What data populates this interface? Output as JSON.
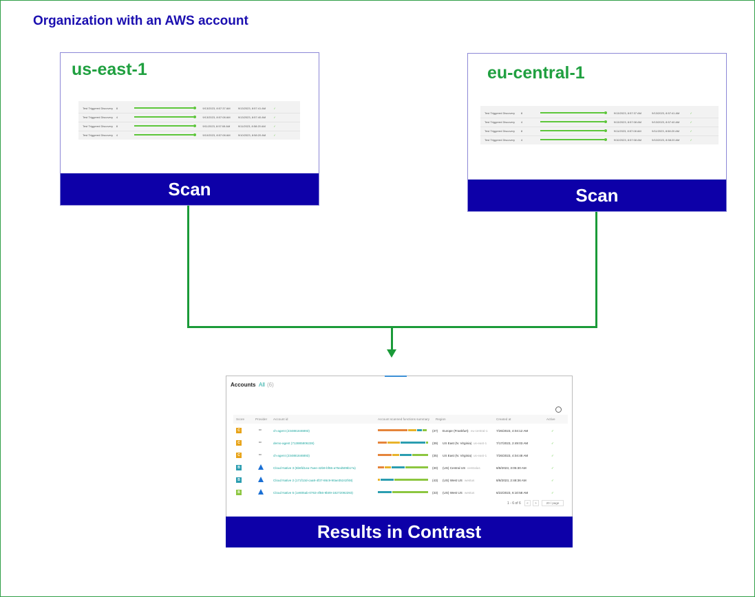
{
  "org_title": "Organization with an AWS account",
  "regions": [
    {
      "name": "us-east-1",
      "scan_label": "Scan",
      "rows": [
        {
          "name": "Test Triggered Discovery",
          "count": "8",
          "start": "9/13/2023, 8:57:37 AM",
          "end": "9/13/2023, 8:57:41 AM",
          "status": "✓"
        },
        {
          "name": "Test Triggered Discovery",
          "count": "4",
          "start": "9/13/2023, 8:57:08 AM",
          "end": "9/13/2023, 8:57:40 AM",
          "status": "✓"
        },
        {
          "name": "Test Triggered Discovery",
          "count": "8",
          "start": "9/11/2023, 8:57:08 AM",
          "end": "9/11/2023, 8:58:20 AM",
          "status": "✓"
        },
        {
          "name": "Test Triggered Discovery",
          "count": "4",
          "start": "9/10/2023, 8:57:08 AM",
          "end": "9/10/2023, 8:58:20 AM",
          "status": "✓"
        }
      ]
    },
    {
      "name": "eu-central-1",
      "scan_label": "Scan",
      "rows": [
        {
          "name": "Test Triggered Discovery",
          "count": "8",
          "start": "9/13/2023, 8:57:37 AM",
          "end": "9/13/2023, 8:57:41 AM",
          "status": "✓"
        },
        {
          "name": "Test Triggered Discovery",
          "count": "4",
          "start": "9/13/2023, 8:57:08 AM",
          "end": "9/13/2023, 8:57:40 AM",
          "status": "✓"
        },
        {
          "name": "Test Triggered Discovery",
          "count": "8",
          "start": "9/11/2023, 8:57:08 AM",
          "end": "9/11/2023, 8:58:20 AM",
          "status": "✓"
        },
        {
          "name": "Test Triggered Discovery",
          "count": "4",
          "start": "9/10/2023, 8:57:08 AM",
          "end": "9/10/2023, 8:58:20 AM",
          "status": "✓"
        }
      ]
    }
  ],
  "results": {
    "title": "Accounts",
    "filter_all": "All",
    "filter_count": "(6)",
    "columns": [
      "Score",
      "Provider",
      "Account id",
      "Account scanned functions summary",
      "Region",
      "Created at",
      "Active"
    ],
    "rows": [
      {
        "score": "C",
        "score_color": "#e8a317",
        "provider": "aws",
        "account": "ch-agent (234881846893)",
        "count": "(37)",
        "region": "Europe (Frankfurt)",
        "region_code": "eu-central-1",
        "created": "7/26/2023, 4:04:12 AM",
        "segments": [
          {
            "frac": 0.58,
            "color": "#e5843a"
          },
          {
            "frac": 0.17,
            "color": "#e8b32a"
          },
          {
            "frac": 0.1,
            "color": "#2a9db0"
          },
          {
            "frac": 0.1,
            "color": "#8cc63f"
          }
        ]
      },
      {
        "score": "C",
        "score_color": "#e8a317",
        "provider": "aws",
        "account": "demo-agent (713885806228)",
        "count": "(39)",
        "region": "US East (N. Virginia)",
        "region_code": "us-east-1",
        "created": "7/17/2023, 2:49:03 AM",
        "segments": [
          {
            "frac": 0.18,
            "color": "#e5843a"
          },
          {
            "frac": 0.26,
            "color": "#e8b32a"
          },
          {
            "frac": 0.48,
            "color": "#2a9db0"
          },
          {
            "frac": 0.05,
            "color": "#8cc63f"
          }
        ]
      },
      {
        "score": "C",
        "score_color": "#e8a317",
        "provider": "aws",
        "account": "ch-agent (234881846893)",
        "count": "(35)",
        "region": "US East (N. Virginia)",
        "region_code": "us-east-1",
        "created": "7/26/2023, 4:04:48 AM",
        "segments": [
          {
            "frac": 0.28,
            "color": "#e5843a"
          },
          {
            "frac": 0.14,
            "color": "#e8b32a"
          },
          {
            "frac": 0.24,
            "color": "#2a9db0"
          },
          {
            "frac": 0.32,
            "color": "#8cc63f"
          }
        ]
      },
      {
        "score": "B",
        "score_color": "#2a9db0",
        "provider": "azure",
        "account": "Cloud Native 3 (6b6fd1ea-7aee-42b9-bf55-a75ed509b17a)",
        "count": "(30)",
        "region": "(US) Central US",
        "region_code": "centralus",
        "created": "8/8/2023, 3:05:30 AM",
        "segments": [
          {
            "frac": 0.13,
            "color": "#e5843a"
          },
          {
            "frac": 0.13,
            "color": "#e8b32a"
          },
          {
            "frac": 0.27,
            "color": "#2a9db0"
          },
          {
            "frac": 0.45,
            "color": "#8cc63f"
          }
        ]
      },
      {
        "score": "B",
        "score_color": "#2a9db0",
        "provider": "azure",
        "account": "Cloud Native 2 (171f13d-caa8-4f37-86c9-90ae35242f48)",
        "count": "(43)",
        "region": "(US) West US",
        "region_code": "westus",
        "created": "8/8/2023, 2:48:36 AM",
        "segments": [
          {
            "frac": 0.05,
            "color": "#e8b32a"
          },
          {
            "frac": 0.27,
            "color": "#2a9db0"
          },
          {
            "frac": 0.66,
            "color": "#8cc63f"
          }
        ]
      },
      {
        "score": "B",
        "score_color": "#8cc63f",
        "provider": "azure",
        "account": "Cloud Native 5 (1e805ab-0763-4f56-9b09-18272092293)",
        "count": "(33)",
        "region": "(US) West US",
        "region_code": "westus",
        "created": "6/22/2023, 6:10:58 AM",
        "segments": [
          {
            "frac": 0.28,
            "color": "#2a9db0"
          },
          {
            "frac": 0.7,
            "color": "#8cc63f"
          }
        ]
      }
    ],
    "pagination": "1 - 6 of 6",
    "page_prev": "<",
    "page_next": ">",
    "page_size": "20 / page",
    "banner": "Results in Contrast"
  },
  "colors": {
    "accent_blue": "#0d00a8",
    "accent_green": "#1a9a38",
    "title_blue": "#1b0fb0"
  }
}
